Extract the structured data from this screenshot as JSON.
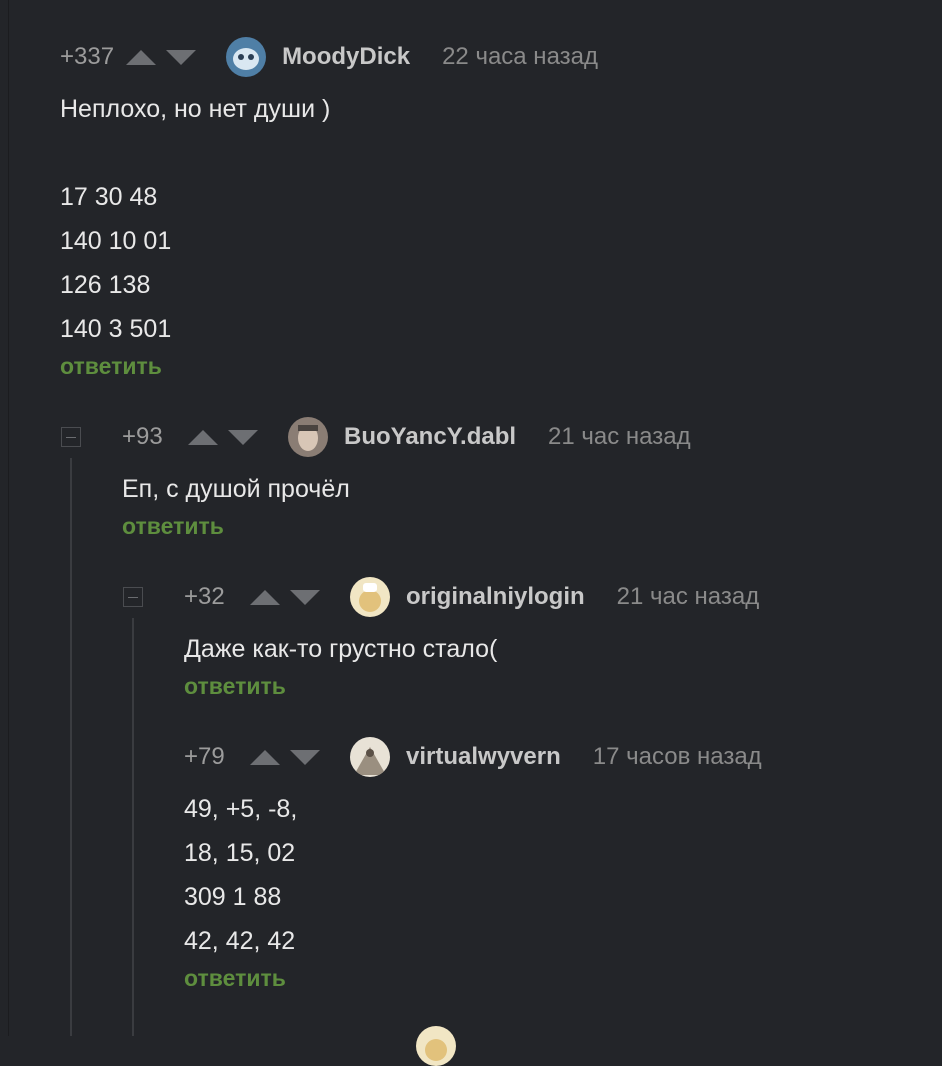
{
  "comments": [
    {
      "rating": "+337",
      "username": "MoodyDick",
      "time": "22 часа назад",
      "lines": [
        "Неплохо, но нет души )",
        "",
        "17 30 48",
        "140 10 01",
        "126 138",
        "140 3 501"
      ],
      "reply": "ответить",
      "avatar": {
        "bg": "#4f7fa6",
        "fg": "#d9e7f2"
      }
    },
    {
      "rating": "+93",
      "username": "BuoYancY.dabl",
      "time": "21 час назад",
      "lines": [
        "Еп, с душой прочёл"
      ],
      "reply": "ответить",
      "avatar": {
        "bg": "#8a7d74",
        "fg": "#d8c6b6"
      }
    },
    {
      "rating": "+32",
      "username": "originalniylogin",
      "time": "21 час назад",
      "lines": [
        "Даже как-то грустно стало("
      ],
      "reply": "ответить",
      "avatar": {
        "bg": "#eadcb0",
        "fg": "#c9a86a"
      }
    },
    {
      "rating": "+79",
      "username": "virtualwyvern",
      "time": "17 часов назад",
      "lines": [
        "49, +5, -8,",
        "18, 15, 02",
        "309 1 88",
        "42, 42, 42"
      ],
      "reply": "ответить",
      "avatar": {
        "bg": "#9a8f80",
        "fg": "#e8e2d6"
      }
    }
  ]
}
